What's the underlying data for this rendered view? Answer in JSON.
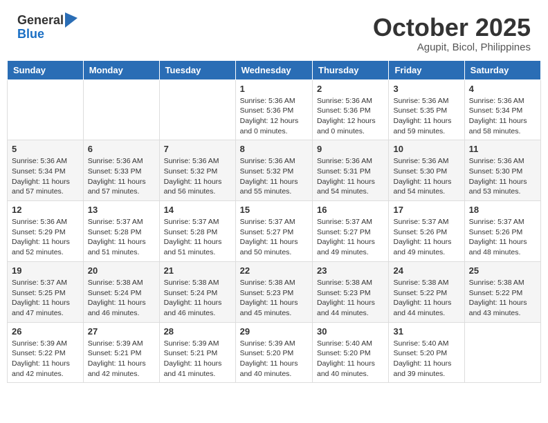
{
  "header": {
    "logo_general": "General",
    "logo_blue": "Blue",
    "month": "October 2025",
    "location": "Agupit, Bicol, Philippines"
  },
  "weekdays": [
    "Sunday",
    "Monday",
    "Tuesday",
    "Wednesday",
    "Thursday",
    "Friday",
    "Saturday"
  ],
  "weeks": [
    [
      {
        "day": "",
        "info": ""
      },
      {
        "day": "",
        "info": ""
      },
      {
        "day": "",
        "info": ""
      },
      {
        "day": "1",
        "info": "Sunrise: 5:36 AM\nSunset: 5:36 PM\nDaylight: 12 hours\nand 0 minutes."
      },
      {
        "day": "2",
        "info": "Sunrise: 5:36 AM\nSunset: 5:36 PM\nDaylight: 12 hours\nand 0 minutes."
      },
      {
        "day": "3",
        "info": "Sunrise: 5:36 AM\nSunset: 5:35 PM\nDaylight: 11 hours\nand 59 minutes."
      },
      {
        "day": "4",
        "info": "Sunrise: 5:36 AM\nSunset: 5:34 PM\nDaylight: 11 hours\nand 58 minutes."
      }
    ],
    [
      {
        "day": "5",
        "info": "Sunrise: 5:36 AM\nSunset: 5:34 PM\nDaylight: 11 hours\nand 57 minutes."
      },
      {
        "day": "6",
        "info": "Sunrise: 5:36 AM\nSunset: 5:33 PM\nDaylight: 11 hours\nand 57 minutes."
      },
      {
        "day": "7",
        "info": "Sunrise: 5:36 AM\nSunset: 5:32 PM\nDaylight: 11 hours\nand 56 minutes."
      },
      {
        "day": "8",
        "info": "Sunrise: 5:36 AM\nSunset: 5:32 PM\nDaylight: 11 hours\nand 55 minutes."
      },
      {
        "day": "9",
        "info": "Sunrise: 5:36 AM\nSunset: 5:31 PM\nDaylight: 11 hours\nand 54 minutes."
      },
      {
        "day": "10",
        "info": "Sunrise: 5:36 AM\nSunset: 5:30 PM\nDaylight: 11 hours\nand 54 minutes."
      },
      {
        "day": "11",
        "info": "Sunrise: 5:36 AM\nSunset: 5:30 PM\nDaylight: 11 hours\nand 53 minutes."
      }
    ],
    [
      {
        "day": "12",
        "info": "Sunrise: 5:36 AM\nSunset: 5:29 PM\nDaylight: 11 hours\nand 52 minutes."
      },
      {
        "day": "13",
        "info": "Sunrise: 5:37 AM\nSunset: 5:28 PM\nDaylight: 11 hours\nand 51 minutes."
      },
      {
        "day": "14",
        "info": "Sunrise: 5:37 AM\nSunset: 5:28 PM\nDaylight: 11 hours\nand 51 minutes."
      },
      {
        "day": "15",
        "info": "Sunrise: 5:37 AM\nSunset: 5:27 PM\nDaylight: 11 hours\nand 50 minutes."
      },
      {
        "day": "16",
        "info": "Sunrise: 5:37 AM\nSunset: 5:27 PM\nDaylight: 11 hours\nand 49 minutes."
      },
      {
        "day": "17",
        "info": "Sunrise: 5:37 AM\nSunset: 5:26 PM\nDaylight: 11 hours\nand 49 minutes."
      },
      {
        "day": "18",
        "info": "Sunrise: 5:37 AM\nSunset: 5:26 PM\nDaylight: 11 hours\nand 48 minutes."
      }
    ],
    [
      {
        "day": "19",
        "info": "Sunrise: 5:37 AM\nSunset: 5:25 PM\nDaylight: 11 hours\nand 47 minutes."
      },
      {
        "day": "20",
        "info": "Sunrise: 5:38 AM\nSunset: 5:24 PM\nDaylight: 11 hours\nand 46 minutes."
      },
      {
        "day": "21",
        "info": "Sunrise: 5:38 AM\nSunset: 5:24 PM\nDaylight: 11 hours\nand 46 minutes."
      },
      {
        "day": "22",
        "info": "Sunrise: 5:38 AM\nSunset: 5:23 PM\nDaylight: 11 hours\nand 45 minutes."
      },
      {
        "day": "23",
        "info": "Sunrise: 5:38 AM\nSunset: 5:23 PM\nDaylight: 11 hours\nand 44 minutes."
      },
      {
        "day": "24",
        "info": "Sunrise: 5:38 AM\nSunset: 5:22 PM\nDaylight: 11 hours\nand 44 minutes."
      },
      {
        "day": "25",
        "info": "Sunrise: 5:38 AM\nSunset: 5:22 PM\nDaylight: 11 hours\nand 43 minutes."
      }
    ],
    [
      {
        "day": "26",
        "info": "Sunrise: 5:39 AM\nSunset: 5:22 PM\nDaylight: 11 hours\nand 42 minutes."
      },
      {
        "day": "27",
        "info": "Sunrise: 5:39 AM\nSunset: 5:21 PM\nDaylight: 11 hours\nand 42 minutes."
      },
      {
        "day": "28",
        "info": "Sunrise: 5:39 AM\nSunset: 5:21 PM\nDaylight: 11 hours\nand 41 minutes."
      },
      {
        "day": "29",
        "info": "Sunrise: 5:39 AM\nSunset: 5:20 PM\nDaylight: 11 hours\nand 40 minutes."
      },
      {
        "day": "30",
        "info": "Sunrise: 5:40 AM\nSunset: 5:20 PM\nDaylight: 11 hours\nand 40 minutes."
      },
      {
        "day": "31",
        "info": "Sunrise: 5:40 AM\nSunset: 5:20 PM\nDaylight: 11 hours\nand 39 minutes."
      },
      {
        "day": "",
        "info": ""
      }
    ]
  ]
}
